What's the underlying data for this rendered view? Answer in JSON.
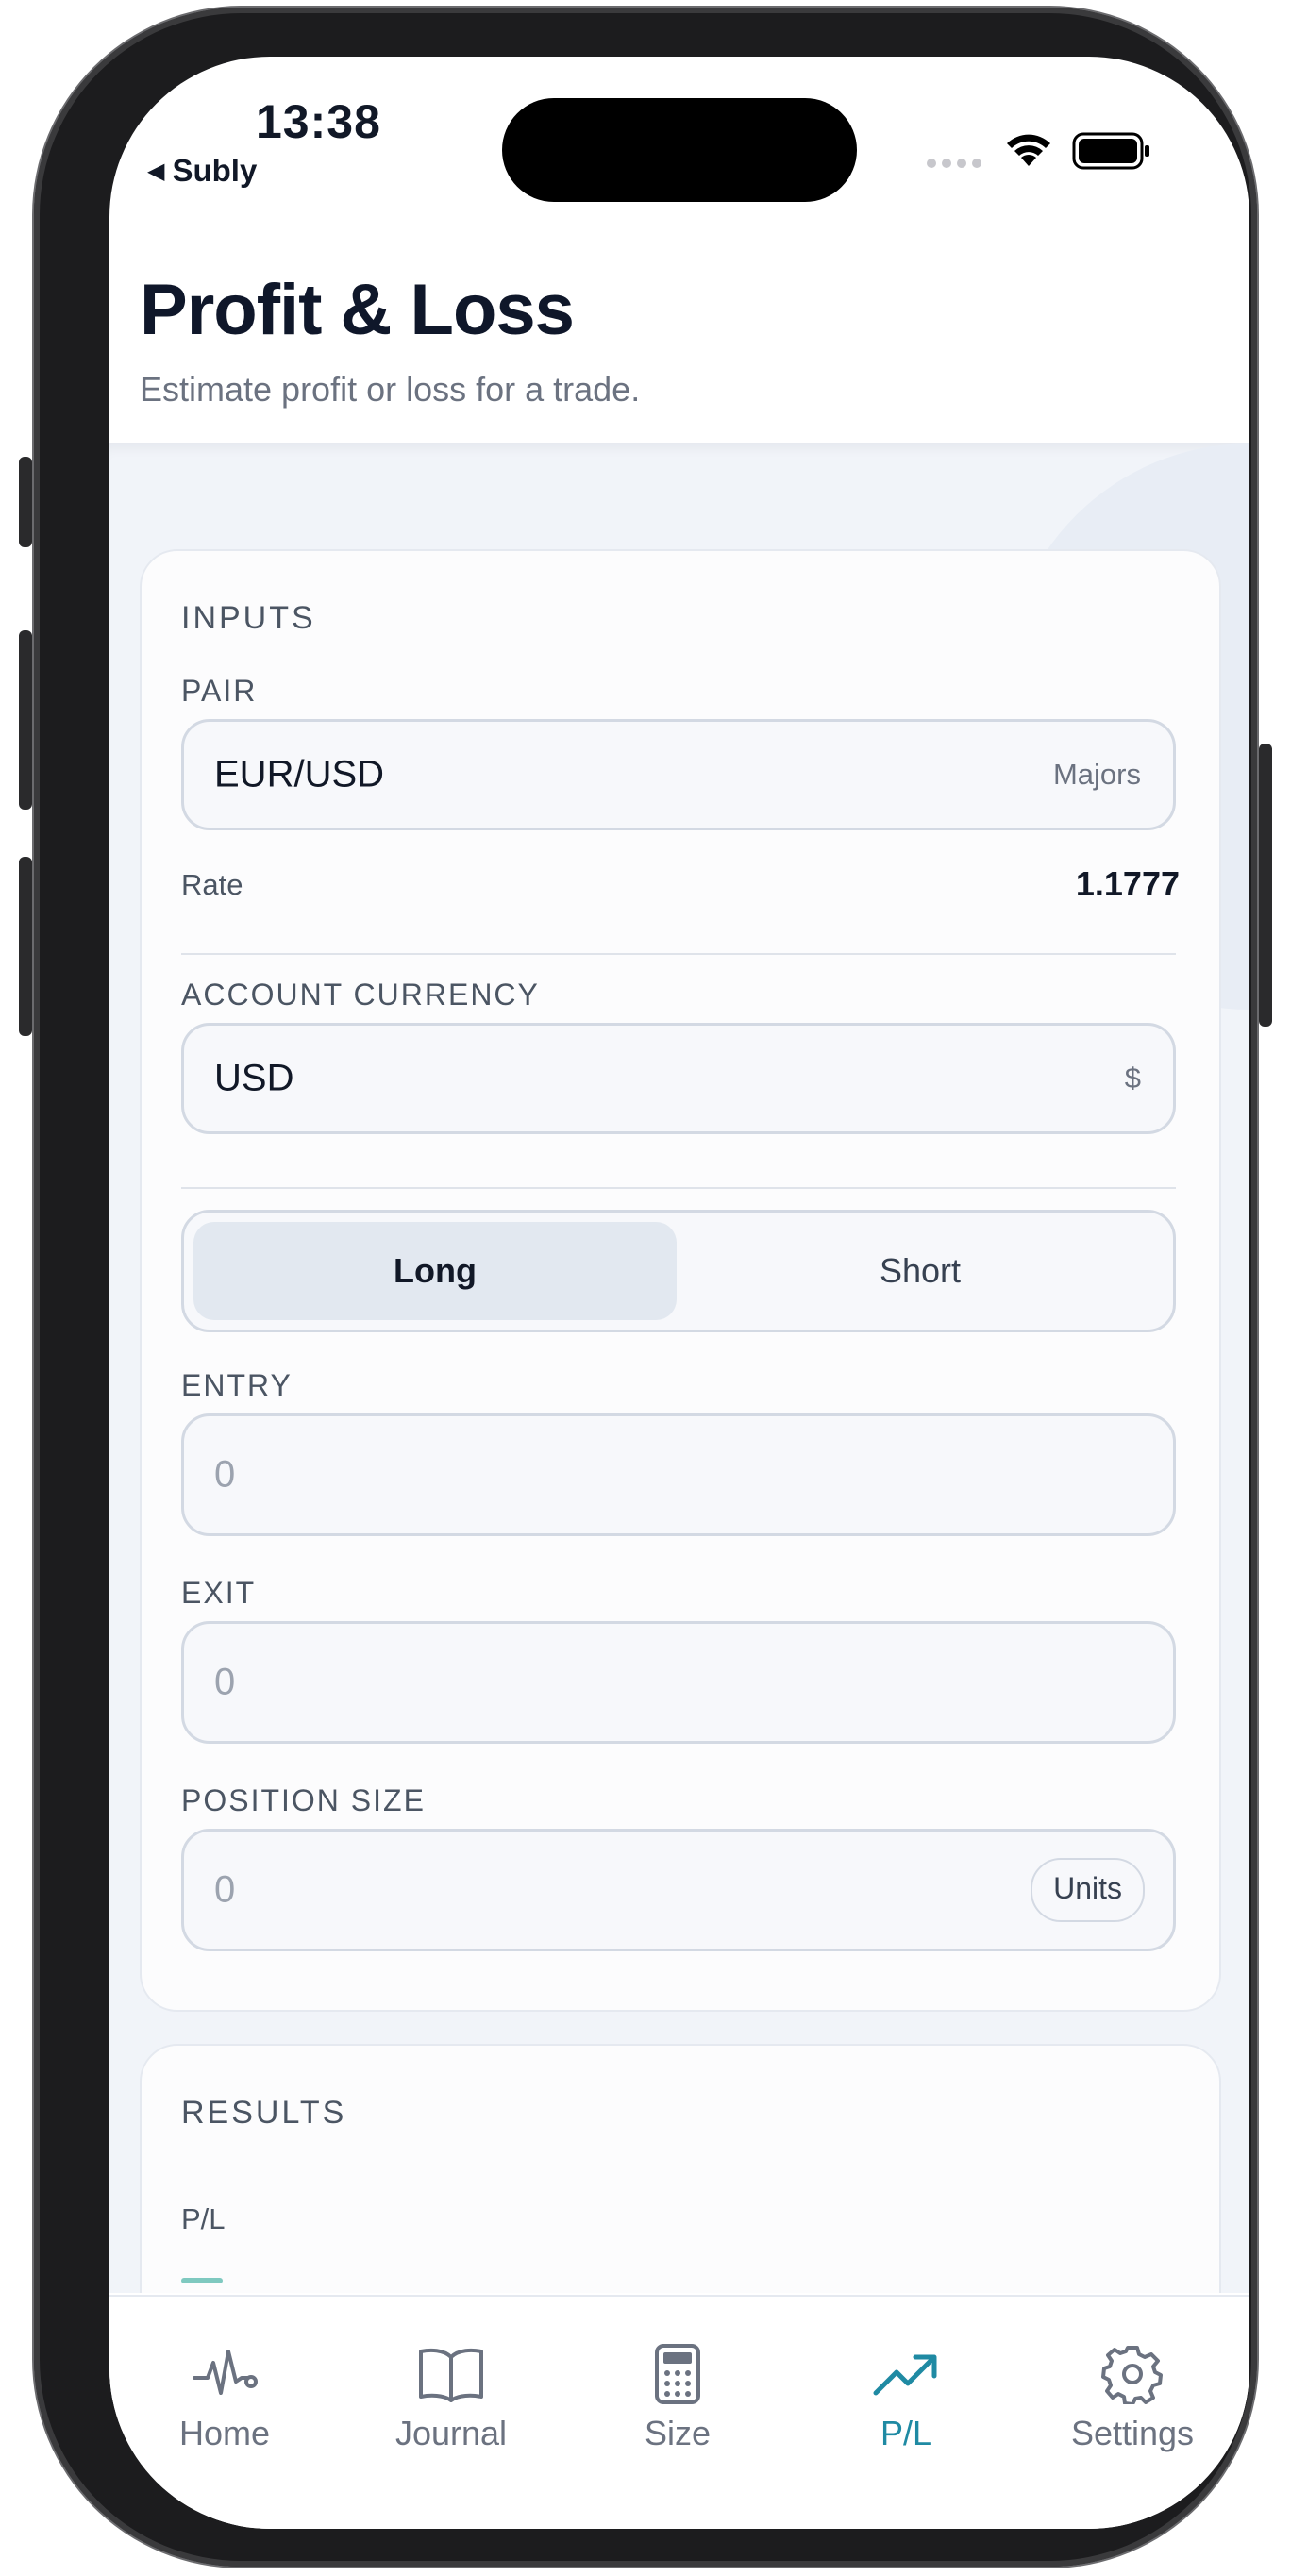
{
  "status_bar": {
    "time": "13:38",
    "back_app": "Subly",
    "icons": [
      "signal-dots-icon",
      "wifi-icon",
      "battery-icon"
    ]
  },
  "header": {
    "title": "Profit & Loss",
    "subtitle": "Estimate profit or loss for a trade."
  },
  "inputs": {
    "section_title": "INPUTS",
    "pair_label": "PAIR",
    "pair_value": "EUR/USD",
    "pair_group": "Majors",
    "rate_label": "Rate",
    "rate_value": "1.1777",
    "account_currency_label": "ACCOUNT CURRENCY",
    "account_currency_value": "USD",
    "account_currency_symbol": "$",
    "direction_options": [
      "Long",
      "Short"
    ],
    "direction_selected": "Long",
    "entry_label": "ENTRY",
    "entry_placeholder": "0",
    "exit_label": "EXIT",
    "exit_placeholder": "0",
    "position_size_label": "POSITION SIZE",
    "position_size_placeholder": "0",
    "position_size_unit": "Units"
  },
  "results": {
    "section_title": "RESULTS",
    "pl_label": "P/L"
  },
  "tabbar": {
    "items": [
      {
        "label": "Home",
        "icon": "pulse-icon"
      },
      {
        "label": "Journal",
        "icon": "book-icon"
      },
      {
        "label": "Size",
        "icon": "calculator-icon"
      },
      {
        "label": "P/L",
        "icon": "trending-up-icon"
      },
      {
        "label": "Settings",
        "icon": "gear-icon"
      }
    ],
    "active": "P/L"
  },
  "colors": {
    "accent": "#1f8aa3",
    "pl_dash": "#7fc9c0",
    "background": "#f1f4f9",
    "title": "#0f172a"
  }
}
